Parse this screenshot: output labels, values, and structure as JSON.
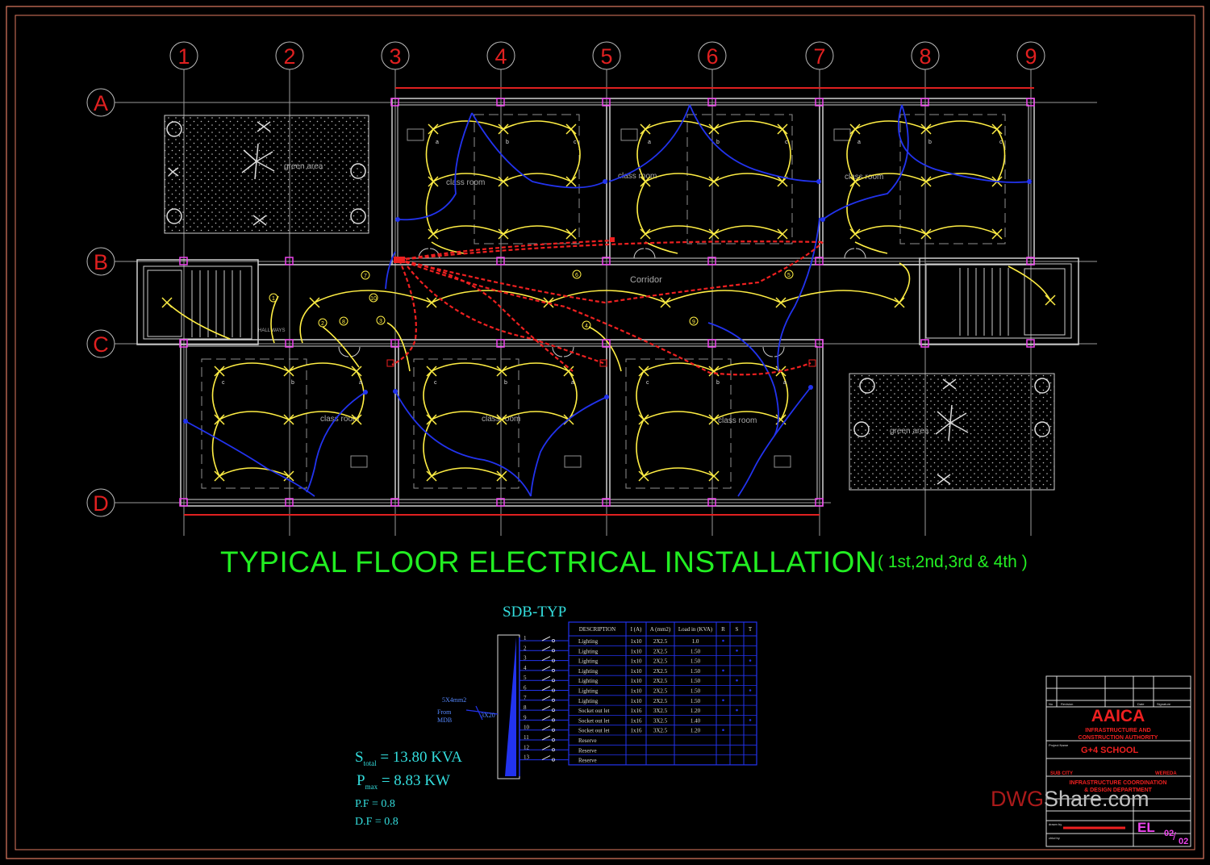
{
  "drawing": {
    "title": "TYPICAL FLOOR ELECTRICAL INSTALLATION",
    "floors_note": "( 1st,2nd,3rd & 4th )",
    "grid_columns": [
      "1",
      "2",
      "3",
      "4",
      "5",
      "6",
      "7",
      "8",
      "9"
    ],
    "grid_rows": [
      "A",
      "B",
      "C",
      "D"
    ],
    "room_labels": [
      "class room",
      "class room",
      "class room",
      "class room",
      "class room",
      "class room"
    ],
    "corridor_label": "Corridor",
    "green_area_labels": [
      "green area",
      "green area"
    ],
    "hall_label": "HALL WAYS",
    "circuit_numbers": [
      "1",
      "2",
      "3",
      "4",
      "5",
      "6",
      "7",
      "8",
      "9",
      "10"
    ],
    "fixture_letters": [
      "a",
      "b",
      "c"
    ]
  },
  "sdb": {
    "title": "SDB-TYP",
    "feeder_cable": "5X4mm2",
    "feeder_from": "From",
    "feeder_source": "MDB",
    "breaker": "3X20",
    "columns": [
      "DESCRIPTION",
      "I (A)",
      "A (mm2)",
      "Load in (KVA)",
      "R",
      "S",
      "T"
    ],
    "rows": [
      {
        "no": "1",
        "desc": "Lighting",
        "i": "1x10",
        "a": "2X2.5",
        "load": "1.0",
        "phase": "R"
      },
      {
        "no": "2",
        "desc": "Lighting",
        "i": "1x10",
        "a": "2X2.5",
        "load": "1.50",
        "phase": "S"
      },
      {
        "no": "3",
        "desc": "Lighting",
        "i": "1x10",
        "a": "2X2.5",
        "load": "1.50",
        "phase": "T"
      },
      {
        "no": "4",
        "desc": "Lighting",
        "i": "1x10",
        "a": "2X2.5",
        "load": "1.50",
        "phase": "R"
      },
      {
        "no": "5",
        "desc": "Lighting",
        "i": "1x10",
        "a": "2X2.5",
        "load": "1.50",
        "phase": "S"
      },
      {
        "no": "6",
        "desc": "Lighting",
        "i": "1x10",
        "a": "2X2.5",
        "load": "1.50",
        "phase": "T"
      },
      {
        "no": "7",
        "desc": "Lighting",
        "i": "1x10",
        "a": "2X2.5",
        "load": "1.50",
        "phase": "R"
      },
      {
        "no": "8",
        "desc": "Socket out let",
        "i": "1x16",
        "a": "3X2.5",
        "load": "1.20",
        "phase": "S"
      },
      {
        "no": "9",
        "desc": "Socket out let",
        "i": "1x16",
        "a": "3X2.5",
        "load": "1.40",
        "phase": "T"
      },
      {
        "no": "10",
        "desc": "Socket out let",
        "i": "1x16",
        "a": "3X2.5",
        "load": "1.20",
        "phase": "R"
      },
      {
        "no": "11",
        "desc": "Reserve",
        "i": "",
        "a": "",
        "load": "",
        "phase": ""
      },
      {
        "no": "12",
        "desc": "Reserve",
        "i": "",
        "a": "",
        "load": "",
        "phase": ""
      },
      {
        "no": "13",
        "desc": "Reserve",
        "i": "",
        "a": "",
        "load": "",
        "phase": ""
      }
    ]
  },
  "calc": {
    "s_label": "S",
    "s_sub": "total",
    "s_value": "= 13.80 KVA",
    "p_label": "P",
    "p_sub": "max",
    "p_value": "= 8.83 KW",
    "pf": "P.F = 0.8",
    "df": "D.F = 0.8"
  },
  "title_block": {
    "col_no": "No",
    "col_revision": "Revision",
    "col_date": "Date",
    "col_signature": "Signature",
    "org": "AAICA",
    "org_line1": "INFRASTRUCTURE AND",
    "org_line2": "CONSTRUCTION AUTHORITY",
    "project_label": "Project Name",
    "project": "G+4 SCHOOL",
    "sub_city": "SUB CITY",
    "wereda": "WEREDA",
    "dept_line1": "INFRASTRUCTURE COORDINATION",
    "dept_line2": "& DESIGN DEPARTMENT",
    "sheet_code": "EL",
    "sheet_no": "02",
    "sheet_total": "02",
    "drawn_by": "drawn by",
    "checked_by": "chkd by"
  },
  "watermark": {
    "part1": "DWG",
    "part2": "Share.com"
  },
  "colors": {
    "background": "#000000",
    "grid_bubble": "#e02020",
    "wall": "#d0d0d0",
    "lighting_circuit": "#ffee44",
    "socket_circuit": "#2233ee",
    "feeder": "#ee2020",
    "title_text": "#22ee22",
    "sdb_text": "#33dddd",
    "title_block_red": "#ee2020",
    "magenta": "#ee44ee"
  }
}
